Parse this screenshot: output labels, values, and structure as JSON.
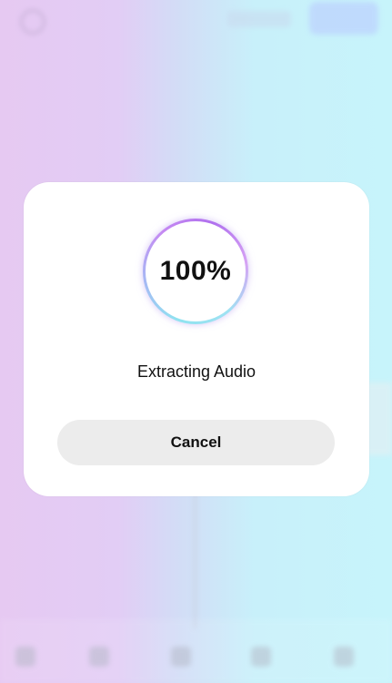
{
  "dialog": {
    "progress_percent": 100,
    "progress_label": "100%",
    "status_text": "Extracting Audio",
    "cancel_label": "Cancel"
  },
  "colors": {
    "ring_gradient": [
      "#8fe3f0",
      "#a6b8f4",
      "#c58af2",
      "#b070ee"
    ],
    "background_left": "#e6c9f2",
    "background_right": "#c7f4fb",
    "cancel_button_bg": "#ececec"
  },
  "icons": {
    "background_back": "back-icon",
    "progress": "progress-ring-icon"
  }
}
